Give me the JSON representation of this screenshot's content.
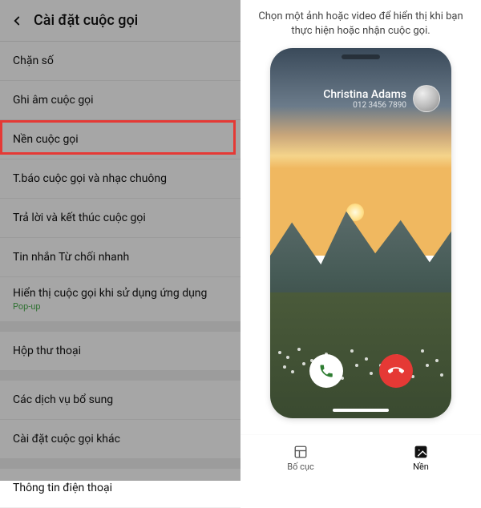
{
  "left": {
    "title": "Cài đặt cuộc gọi",
    "items": [
      {
        "label": "Chặn số"
      },
      {
        "label": "Ghi âm cuộc gọi"
      },
      {
        "label": "Nền cuộc gọi",
        "highlighted": true
      },
      {
        "label": "T.báo cuộc gọi và nhạc chuông"
      },
      {
        "label": "Trả lời và kết thúc cuộc gọi"
      },
      {
        "label": "Tin nhắn Từ chối nhanh"
      },
      {
        "label": "Hiển thị cuộc gọi khi sử dụng ứng dụng",
        "sub": "Pop-up"
      }
    ],
    "group2": [
      {
        "label": "Hộp thư thoại"
      }
    ],
    "group3": [
      {
        "label": "Các dịch vụ bổ sung"
      },
      {
        "label": "Cài đặt cuộc gọi khác"
      }
    ],
    "group4": [
      {
        "label": "Thông tin điện thoại"
      }
    ]
  },
  "right": {
    "description": "Chọn một ảnh hoặc video để hiển thị khi bạn thực hiện hoặc nhận cuộc gọi.",
    "caller_name": "Christina Adams",
    "caller_number": "012 3456 7890",
    "nav": {
      "layout": "Bố cục",
      "background": "Nền"
    }
  }
}
